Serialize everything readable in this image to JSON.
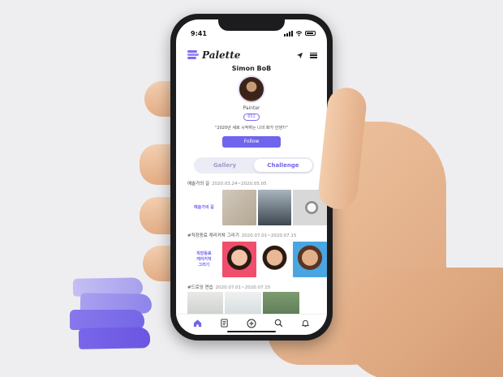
{
  "status_bar": {
    "time": "9:41"
  },
  "app": {
    "logo_text": "Palette"
  },
  "profile": {
    "username": "Simon BoB",
    "role": "Painter",
    "badge": "652",
    "quote": "\"2020년 새로 시작하는 나의 화가 인생?!\"",
    "follow_label": "Follow"
  },
  "tabs": [
    {
      "label": "Gallery",
      "active": false
    },
    {
      "label": "Challenge",
      "active": true
    }
  ],
  "challenges": [
    {
      "title": "예술가의 길",
      "date": "2020.03.24~2020.05.05",
      "label": "예술가의 길"
    },
    {
      "title": "#직장동료 캐리커쳐 그리기",
      "date": "2020.07.01~2020.07.15",
      "label": "직장동료\n캐리커쳐\n그리기"
    },
    {
      "title": "#드로잉 연습",
      "date": "2020.07.01~2020.07.15",
      "label": ""
    }
  ],
  "bottom_nav": [
    "home-icon",
    "feed-icon",
    "add-icon",
    "search-icon",
    "bell-icon"
  ],
  "colors": {
    "accent": "#6f64ee",
    "brush": "#7a66ea"
  }
}
